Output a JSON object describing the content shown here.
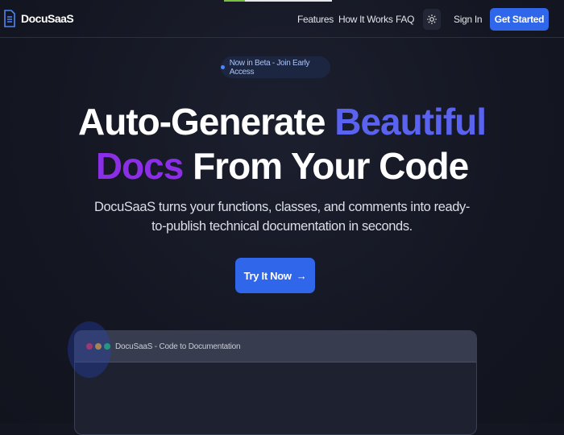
{
  "nav": {
    "brand": "DocuSaaS",
    "links": [
      "Features",
      "How It Works",
      "FAQ"
    ],
    "sign_in": "Sign In",
    "get_started": "Get Started"
  },
  "hero": {
    "badge": "Now in Beta - Join Early Access",
    "title_1": "Auto-Generate ",
    "title_2": "Beautiful",
    "title_3": "Docs",
    "title_4": " From Your Code",
    "subtitle": "DocuSaaS turns your functions, classes, and comments into ready-to-publish technical documentation in seconds.",
    "cta": "Try It Now"
  },
  "preview": {
    "window_title": "DocuSaaS - Code to Documentation"
  },
  "colors": {
    "accent": "#2f66ea",
    "blue": "#5a63f0",
    "purple": "#8b2fe6"
  }
}
